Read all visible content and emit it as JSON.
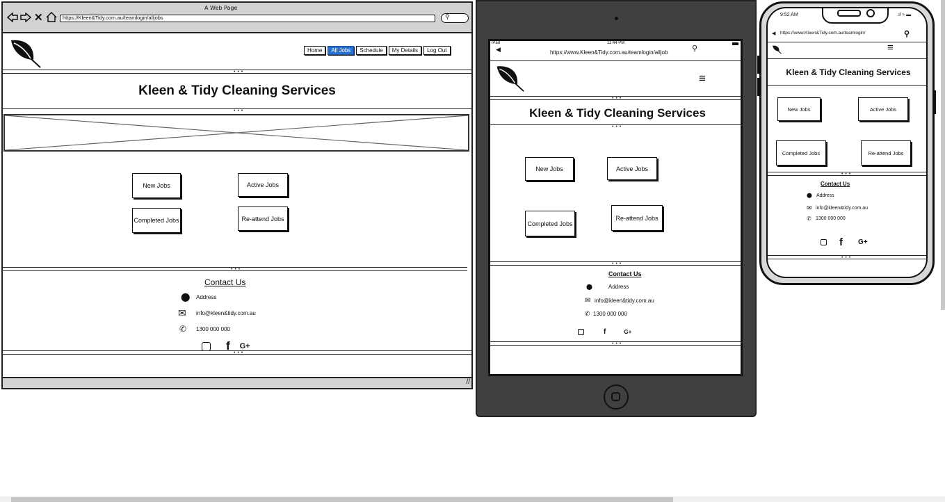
{
  "desktop": {
    "window_title": "A Web Page",
    "url": "https://Kleen&Tidy.com.au/teamlogin/alljobs",
    "nav": [
      "Home",
      "All Jobs",
      "Schedule",
      "My Details",
      "Log Out"
    ],
    "active_nav": "All Jobs",
    "site_title": "Kleen & Tidy Cleaning Services",
    "buttons": [
      "New Jobs",
      "Active Jobs",
      "Completed Jobs",
      "Re-attend Jobs"
    ],
    "contact_heading": "Contact Us",
    "address": "Address",
    "email": "info@kleen&tidy.com.au",
    "phone": "1300 000 000",
    "social": [
      "instagram",
      "facebook",
      "google-plus"
    ]
  },
  "tablet": {
    "status_left": "iPad",
    "time": "11:44 PM",
    "url": "https://www.Kleen&Tidy.com.au/teamlogin/alljob",
    "site_title": "Kleen & Tidy Cleaning Services",
    "buttons": [
      "New Jobs",
      "Active Jobs",
      "Completed Jobs",
      "Re-attend Jobs"
    ],
    "contact_heading": "Contact Us",
    "address": "Address",
    "email": "info@kleen&tidy.com.au",
    "phone": "1300 000 000"
  },
  "phone": {
    "time": "9:52 AM",
    "url": "https://www.Kleen&Tidy.com.au/teamlogin/",
    "site_title": "Kleen & Tidy Cleaning Services",
    "buttons": [
      "New Jobs",
      "Active Jobs",
      "Completed Jobs",
      "Re-attend Jobs"
    ],
    "contact_heading": "Contact Us",
    "address": "Address",
    "email": "info@kleen&tidy.com.au",
    "phone": "1300 000 000"
  },
  "colors": {
    "accent": "#2a72d2",
    "tablet_frame": "#404040",
    "window_chrome": "#d3d3d3"
  }
}
